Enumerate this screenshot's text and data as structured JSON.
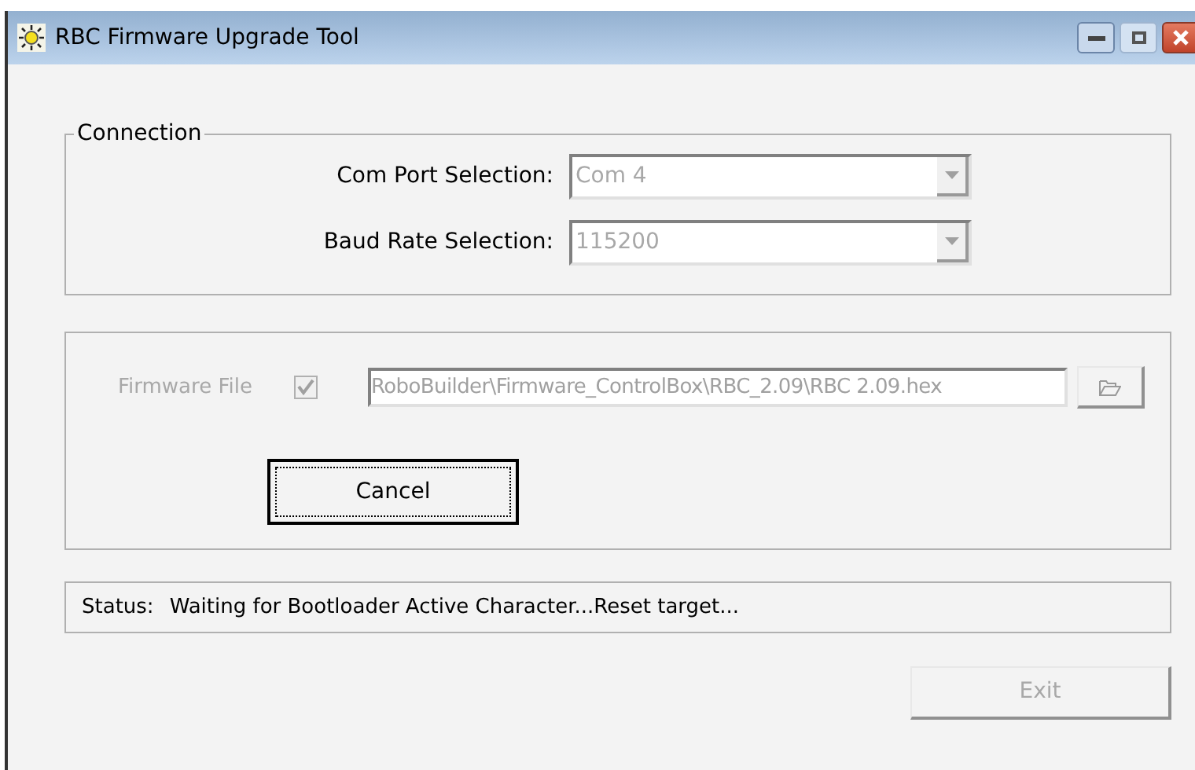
{
  "window": {
    "title": "RBC Firmware Upgrade Tool"
  },
  "connection": {
    "title": "Connection",
    "fields": [
      {
        "label": "Com Port Selection:",
        "value": "Com 4",
        "disabled": true
      },
      {
        "label": "Baud Rate Selection:",
        "value": "115200",
        "disabled": true
      }
    ]
  },
  "firmware": {
    "label": "Firmware File",
    "checked": true,
    "disabled": true,
    "path": "RoboBuilder\\Firmware_ControlBox\\RBC_2.09\\RBC 2.09.hex"
  },
  "cancel_button": {
    "label": "Cancel",
    "focused": true
  },
  "status": {
    "label": "Status:",
    "text": "Waiting for Bootloader Active Character...Reset target..."
  },
  "exit_button": {
    "label": "Exit",
    "disabled": true
  }
}
